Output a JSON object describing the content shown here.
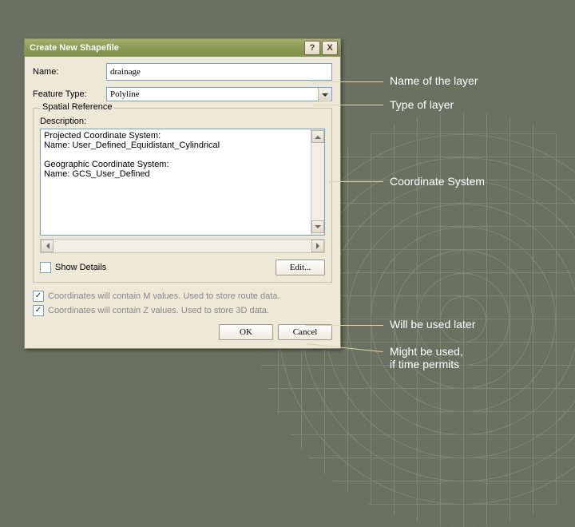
{
  "dialog": {
    "title": "Create New Shapefile",
    "help": "?",
    "close": "X",
    "name_label": "Name:",
    "name_value": "drainage",
    "feature_label": "Feature Type:",
    "feature_value": "Polyline",
    "group_legend": "Spatial Reference",
    "description_label": "Description:",
    "desc_text": "Projected Coordinate System:\n  Name: User_Defined_Equidistant_Cylindrical\n\nGeographic Coordinate System:\n  Name: GCS_User_Defined",
    "show_details": "Show Details",
    "edit": "Edit...",
    "m_values": "Coordinates will contain M values. Used to store route data.",
    "z_values": "Coordinates will contain Z values. Used to store 3D data.",
    "ok": "OK",
    "cancel": "Cancel"
  },
  "annotations": {
    "a1": "Name of the layer",
    "a2": "Type of layer",
    "a3": "Coordinate System",
    "a4": "Will be used later",
    "a5": "Might be used,\nif time permits"
  }
}
